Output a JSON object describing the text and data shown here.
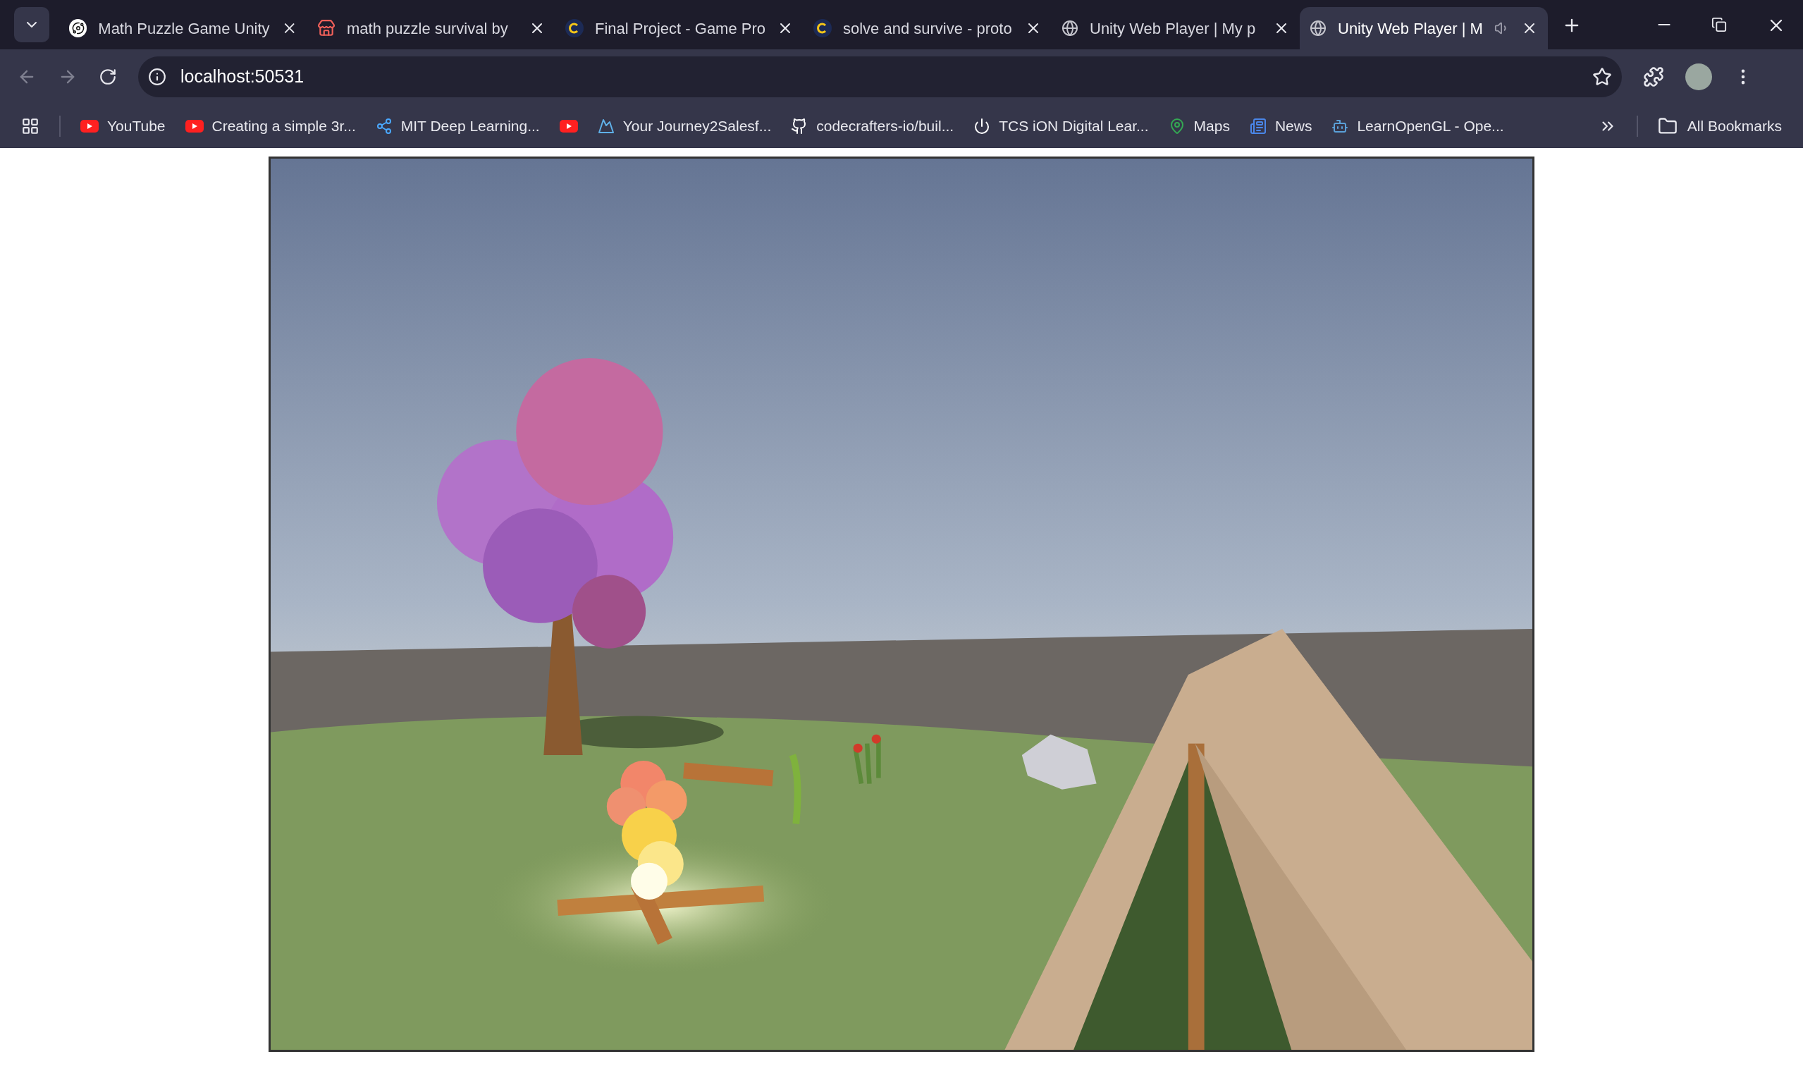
{
  "tabs": [
    {
      "title": "Math Puzzle Game Unity",
      "kind": "swirl",
      "selected": false,
      "audio": false
    },
    {
      "title": "math puzzle survival by",
      "kind": "store",
      "selected": false,
      "audio": false
    },
    {
      "title": "Final Project - Game Pro",
      "kind": "c",
      "selected": false,
      "audio": false
    },
    {
      "title": "solve and survive - proto",
      "kind": "c",
      "selected": false,
      "audio": false
    },
    {
      "title": "Unity Web Player | My p",
      "kind": "globe",
      "selected": false,
      "audio": false
    },
    {
      "title": "Unity Web Player | M",
      "kind": "globe",
      "selected": true,
      "audio": true
    }
  ],
  "address": "localhost:50531",
  "bookmarks": [
    {
      "label": "YouTube",
      "kind": "youtube"
    },
    {
      "label": "Creating a simple 3r...",
      "kind": "youtube"
    },
    {
      "label": "MIT Deep Learning...",
      "kind": "nodes"
    },
    {
      "kind": "youtube"
    },
    {
      "label": "Your Journey2Salesf...",
      "kind": "mountain"
    },
    {
      "label": "codecrafters-io/buil...",
      "kind": "github"
    },
    {
      "label": "TCS iON Digital Lear...",
      "kind": "power"
    },
    {
      "label": "Maps",
      "kind": "pin"
    },
    {
      "label": "News",
      "kind": "news"
    },
    {
      "label": "LearnOpenGL - Ope...",
      "kind": "robot"
    }
  ],
  "all_bookmarks": "All Bookmarks"
}
